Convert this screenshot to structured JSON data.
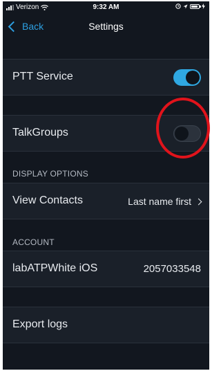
{
  "status_bar": {
    "carrier": "Verizon",
    "time": "9:32 AM",
    "icons": [
      "signal-icon",
      "wifi-icon",
      "alarm-icon",
      "location-icon",
      "battery-icon",
      "charging-icon"
    ]
  },
  "nav": {
    "back_label": "Back",
    "title": "Settings"
  },
  "rows": {
    "ptt_service": {
      "label": "PTT Service",
      "toggle_on": true
    },
    "talkgroups": {
      "label": "TalkGroups",
      "toggle_on": false
    },
    "display_options_header": "DISPLAY OPTIONS",
    "view_contacts": {
      "label": "View Contacts",
      "value": "Last name first"
    },
    "account_header": "ACCOUNT",
    "account": {
      "label": "labATPWhite iOS",
      "value": "2057033548"
    },
    "export_logs": {
      "label": "Export logs"
    }
  },
  "colors": {
    "background": "#12171f",
    "row_background": "#1a2029",
    "accent": "#2fa8e2",
    "annotation": "#e0131b"
  }
}
